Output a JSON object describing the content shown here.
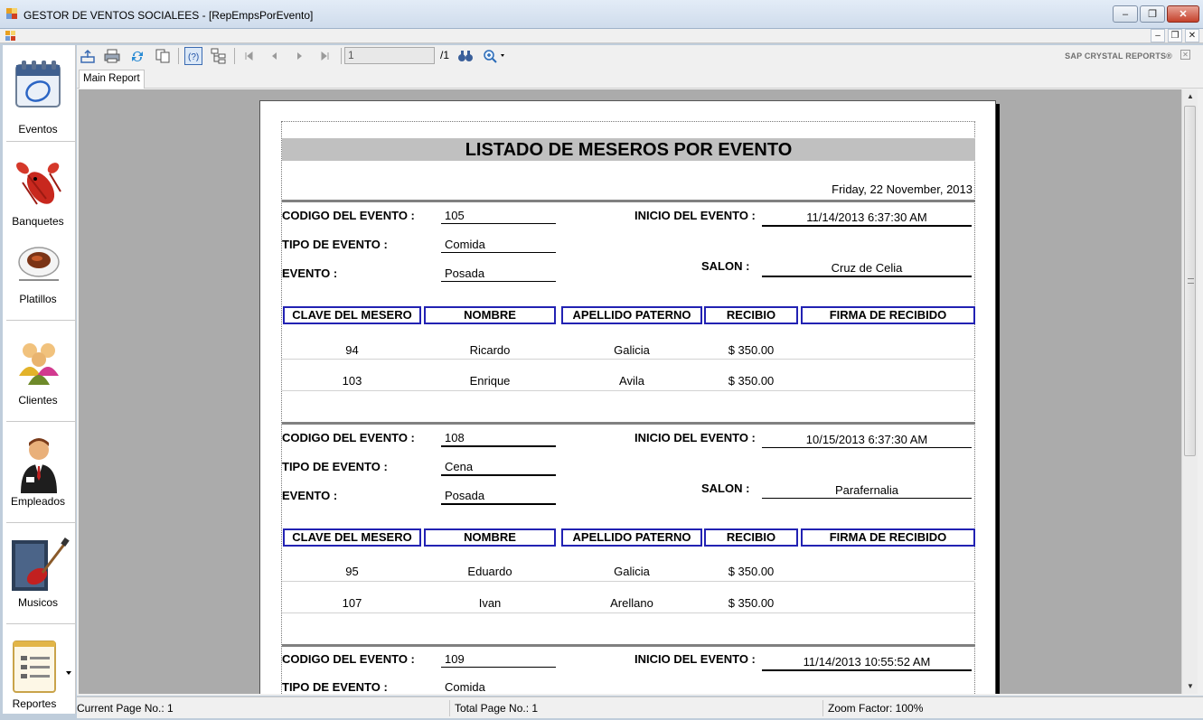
{
  "window": {
    "title": "GESTOR DE VENTOS SOCIALEES - [RepEmpsPorEvento]",
    "minimize": "–",
    "maximize": "❐",
    "close": "✕"
  },
  "mdi": {
    "minimize": "–",
    "restore": "❐",
    "close": "✕"
  },
  "sidebar": {
    "items": [
      {
        "label": "Eventos",
        "icon": "calendar-icon"
      },
      {
        "label": "Banquetes",
        "icon": "lobster-icon"
      },
      {
        "label": "Platillos",
        "icon": "plate-icon"
      },
      {
        "label": "Clientes",
        "icon": "people-icon"
      },
      {
        "label": "Empleados",
        "icon": "employee-icon"
      },
      {
        "label": "Musicos",
        "icon": "guitar-icon"
      },
      {
        "label": "Reportes",
        "icon": "report-icon"
      }
    ]
  },
  "toolbar": {
    "page_value": "1",
    "page_total": "/1",
    "brand": "SAP CRYSTAL REPORTS®",
    "brand_close": "✕"
  },
  "tabs": {
    "main": "Main Report"
  },
  "report": {
    "title": "LISTADO DE MESEROS POR EVENTO",
    "date": "Friday, 22 November, 2013",
    "labels": {
      "codigo": "CODIGO DEL EVENTO  :",
      "tipo": "TIPO DE EVENTO :",
      "evento": "EVENTO :",
      "inicio": "INICIO DEL EVENTO  :",
      "salon": "SALON :"
    },
    "columns": [
      "CLAVE DEL MESERO",
      "NOMBRE",
      "APELLIDO PATERNO",
      "RECIBIO",
      "FIRMA DE RECIBIDO"
    ],
    "groups": [
      {
        "codigo": "105",
        "tipo": "Comida",
        "evento": "Posada",
        "inicio": "11/14/2013 6:37:30 AM",
        "salon": "Cruz de Celia",
        "rows": [
          {
            "clave": "94",
            "nombre": "Ricardo",
            "apellido": "Galicia",
            "recibio": "$ 350.00"
          },
          {
            "clave": "103",
            "nombre": "Enrique",
            "apellido": "Avila",
            "recibio": "$ 350.00"
          }
        ]
      },
      {
        "codigo": "108",
        "tipo": "Cena",
        "evento": "Posada",
        "inicio": "10/15/2013 6:37:30 AM",
        "salon": "Parafernalia",
        "rows": [
          {
            "clave": "95",
            "nombre": "Eduardo",
            "apellido": "Galicia",
            "recibio": "$ 350.00"
          },
          {
            "clave": "107",
            "nombre": "Ivan",
            "apellido": "Arellano",
            "recibio": "$ 350.00"
          }
        ]
      },
      {
        "codigo": "109",
        "tipo": "Comida",
        "inicio": "11/14/2013 10:55:52 AM"
      }
    ]
  },
  "status": {
    "current_page": "Current Page No.: 1",
    "total_page": "Total Page No.: 1",
    "zoom": "Zoom Factor: 100%"
  }
}
